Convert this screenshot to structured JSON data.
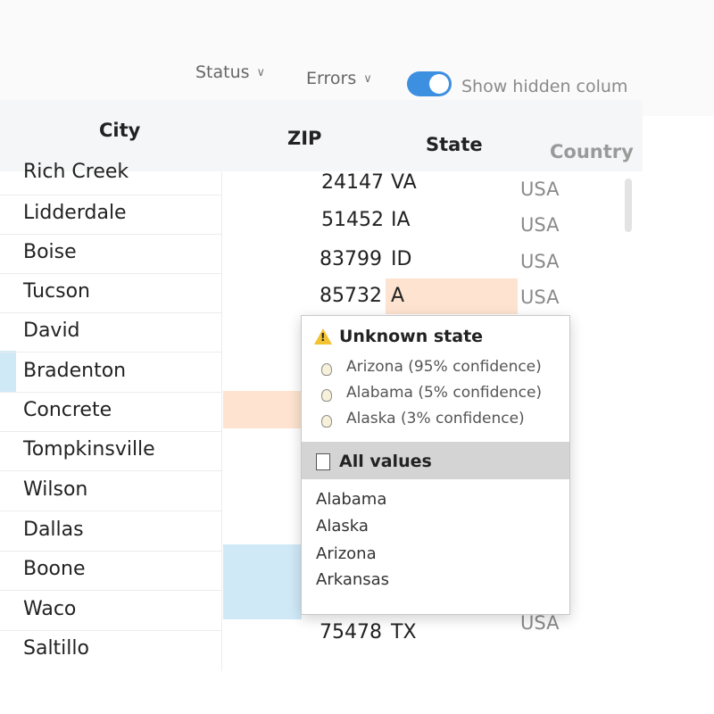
{
  "toolbar": {
    "status_label": "Status",
    "errors_label": "Errors",
    "show_hidden_label": "Show hidden colum",
    "show_hidden_on": true
  },
  "table": {
    "columns": [
      "City",
      "ZIP",
      "State",
      "Country"
    ],
    "cities": [
      "Rich Creek",
      "Lidderdale",
      "Boise",
      "Tucson",
      "David",
      "Bradenton",
      "Concrete",
      "Tompkinsville",
      "Wilson",
      "Dallas",
      "Boone",
      "Waco",
      "Saltillo"
    ],
    "visible_rows": [
      {
        "zip": "24147",
        "state": "VA",
        "country": "USA"
      },
      {
        "zip": "51452",
        "state": "IA",
        "country": "USA"
      },
      {
        "zip": "83799",
        "state": "ID",
        "country": "USA"
      },
      {
        "zip": "85732",
        "state": "A",
        "country": "USA"
      }
    ],
    "last_row": {
      "zip": "75478",
      "state": "TX",
      "country": "USA"
    }
  },
  "popover": {
    "title": "Unknown state",
    "suggestions": [
      "Arizona (95% confidence)",
      "Alabama (5% confidence)",
      "Alaska (3% confidence)"
    ],
    "all_values_label": "All values",
    "all_values": [
      "Alabama",
      "Alaska",
      "Arizona",
      "Arkansas"
    ]
  },
  "colors": {
    "accent": "#3d8fe0",
    "error_highlight": "#fde3d0",
    "selection_highlight": "#cfe9f7",
    "warning": "#f2c230"
  },
  "icons": [
    "chevron-down-icon",
    "warning-icon",
    "lightbulb-icon",
    "document-icon"
  ]
}
